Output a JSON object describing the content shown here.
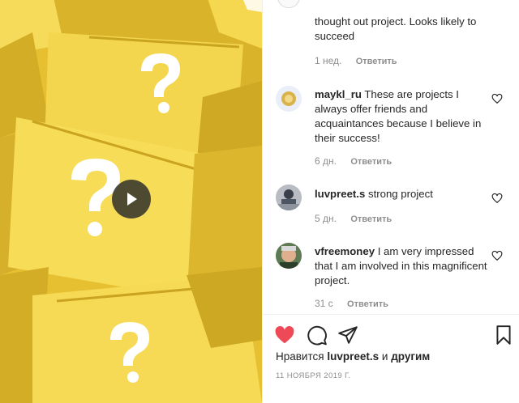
{
  "media": {
    "play_button": "play-icon"
  },
  "comments": [
    {
      "username": "",
      "text": "thought out project. Looks likely to succeed",
      "time": "1 нед.",
      "reply_label": "Ответить"
    },
    {
      "username": "maykl_ru",
      "text": "These are projects I always offer friends and acquaintances because I believe in their success!",
      "time": "6 дн.",
      "reply_label": "Ответить"
    },
    {
      "username": "luvpreet.s",
      "text": "strong project",
      "time": "5 дн.",
      "reply_label": "Ответить"
    },
    {
      "username": "vfreemoney",
      "text": "I am very impressed that I am involved in this magnificent project.",
      "time": "31 с",
      "reply_label": "Ответить"
    }
  ],
  "actions": {
    "icons": [
      "heart-filled-icon",
      "comment-icon",
      "share-icon",
      "bookmark-icon"
    ],
    "like_color": "#ed4956"
  },
  "likes": {
    "prefix": "Нравится",
    "user": "luvpreet.s",
    "joiner": "и",
    "others": "другим"
  },
  "post_date": "11 НОЯБРЯ 2019 Г.",
  "colors": {
    "media_yellow": "#f2d24a",
    "text": "#262626",
    "muted": "#8e8e8e"
  }
}
